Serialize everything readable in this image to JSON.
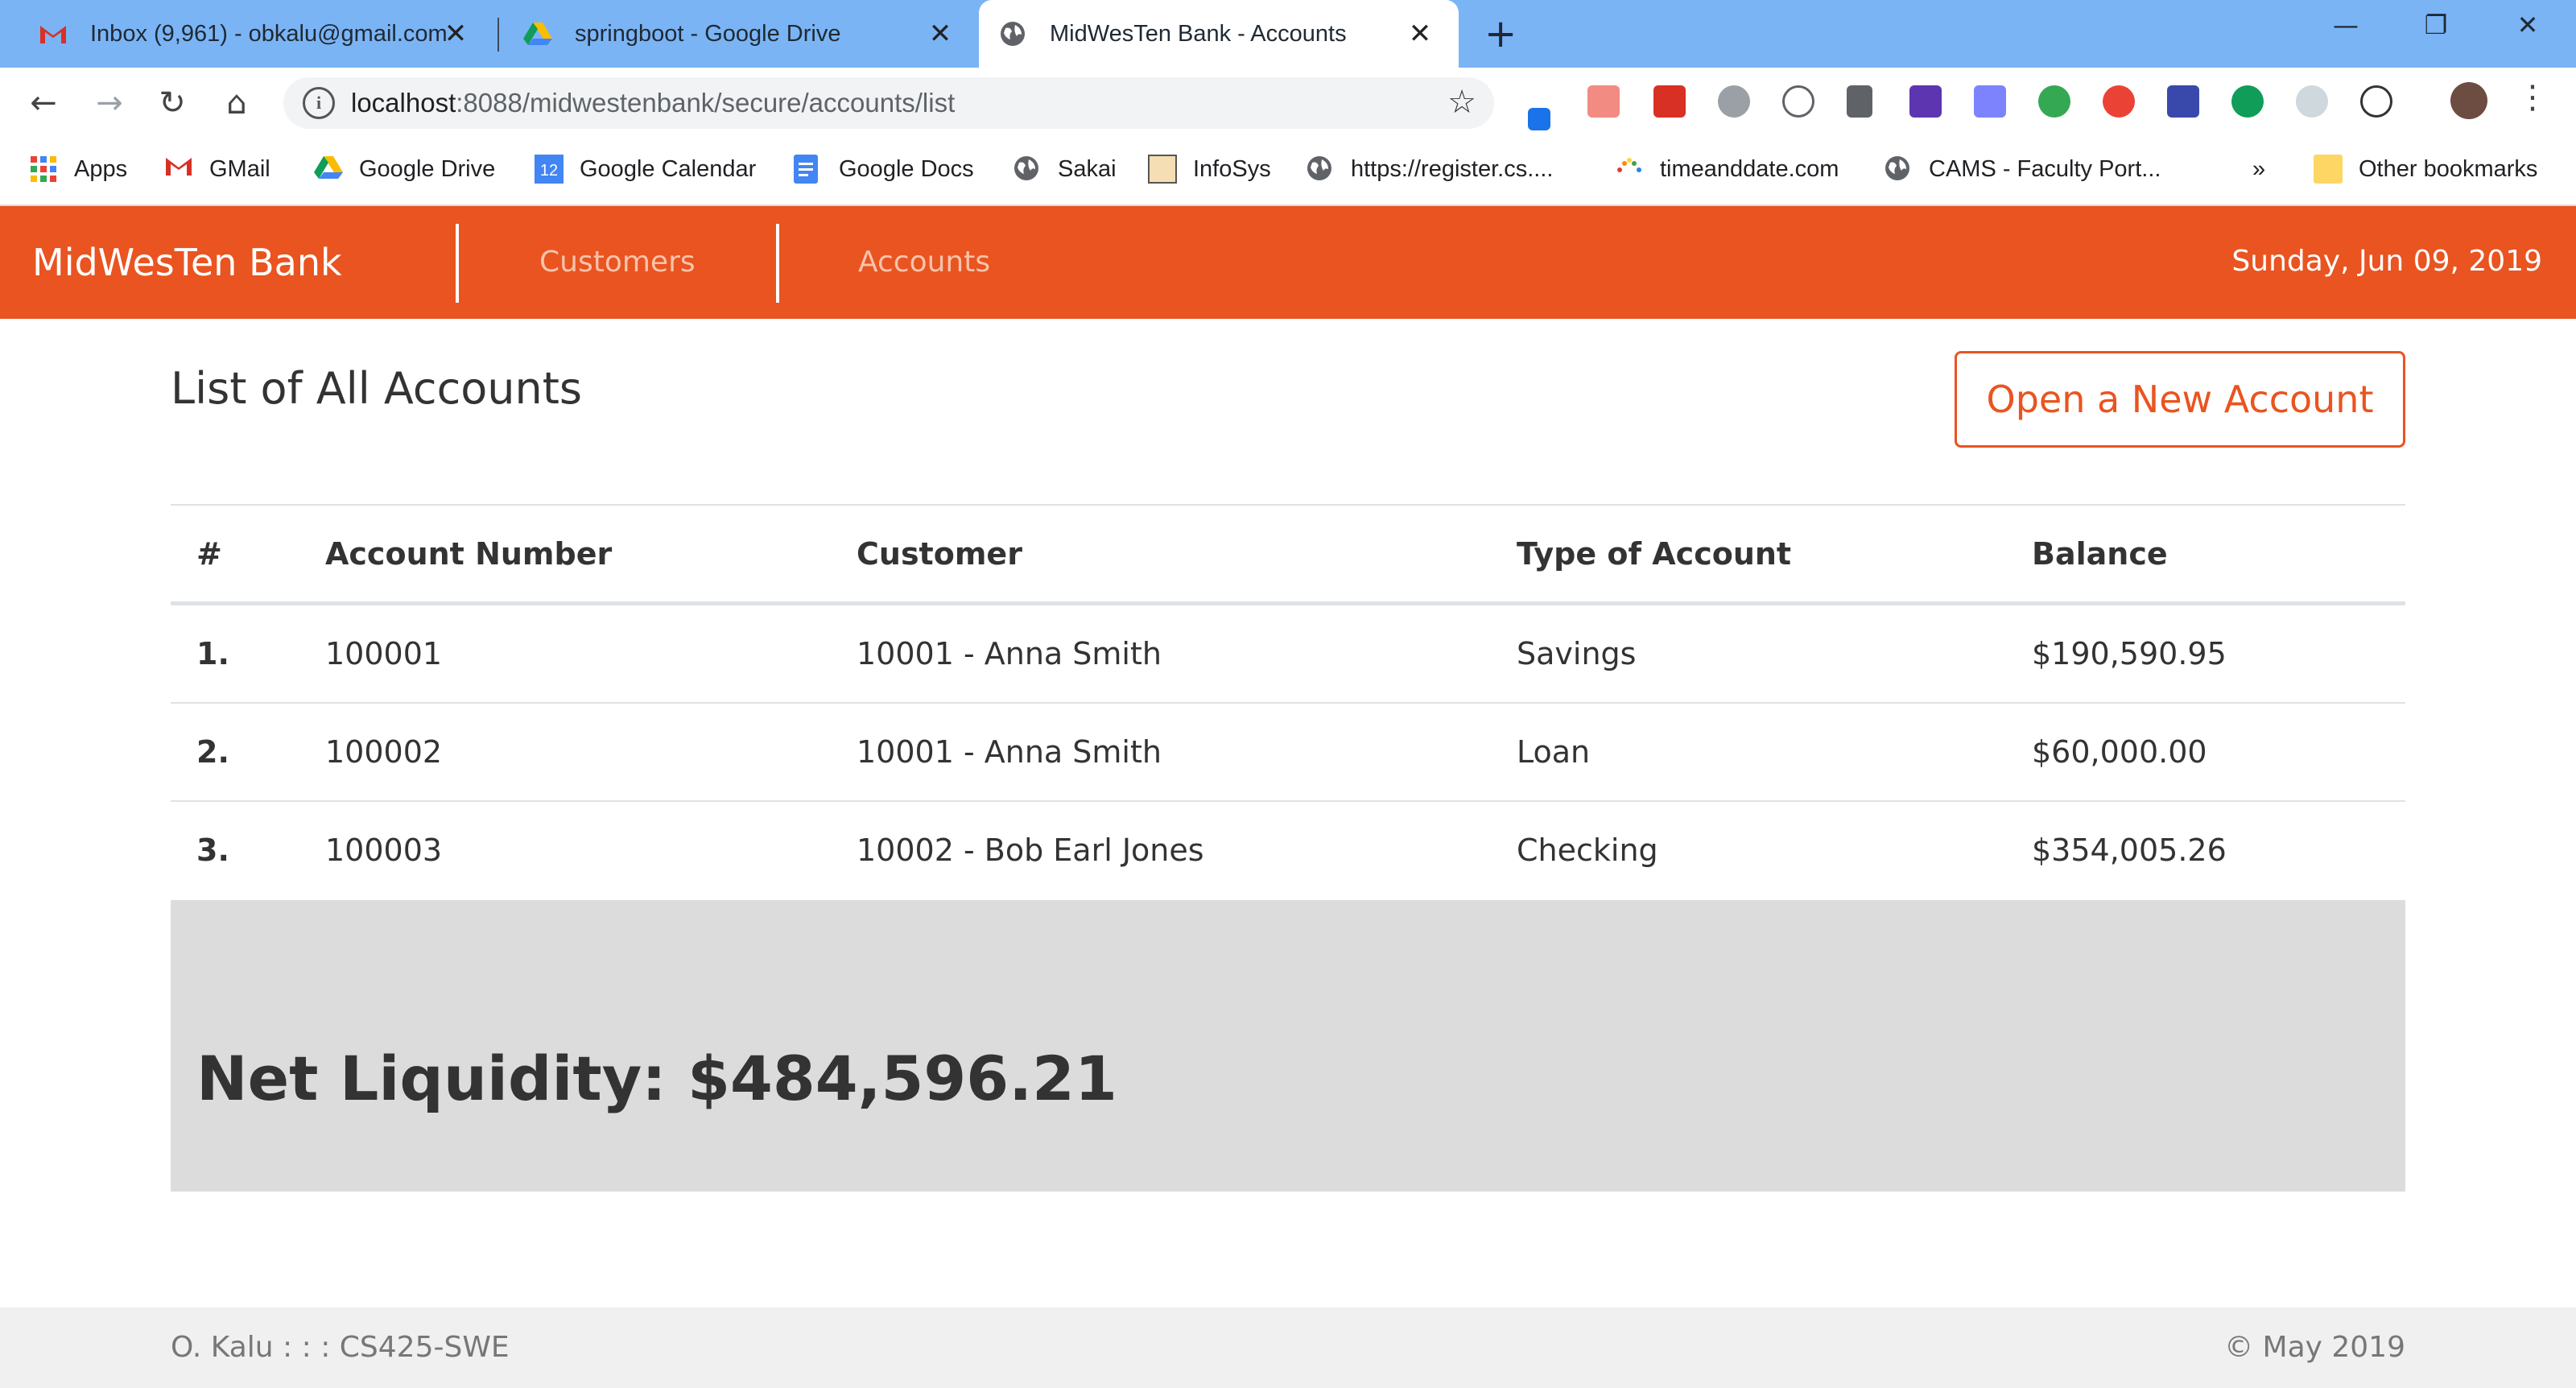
{
  "browser": {
    "tabs": [
      {
        "title": "Inbox (9,961) - obkalu@gmail.com",
        "icon": "gmail-icon"
      },
      {
        "title": "springboot - Google Drive",
        "icon": "google-drive-icon"
      },
      {
        "title": "MidWesTen Bank - Accounts",
        "icon": "globe-icon",
        "active": true
      }
    ],
    "url_host": "localhost",
    "url_path": ":8088/midwestenbank/secure/accounts/list",
    "bookmarks": [
      {
        "label": "Apps",
        "icon": "apps-grid-icon"
      },
      {
        "label": "GMail",
        "icon": "gmail-icon"
      },
      {
        "label": "Google Drive",
        "icon": "google-drive-icon"
      },
      {
        "label": "Google Calendar",
        "icon": "google-calendar-icon"
      },
      {
        "label": "Google Docs",
        "icon": "google-docs-icon"
      },
      {
        "label": "Sakai",
        "icon": "globe-icon"
      },
      {
        "label": "InfoSys",
        "icon": "infosys-icon"
      },
      {
        "label": "https://register.cs....",
        "icon": "globe-icon"
      },
      {
        "label": "timeanddate.com",
        "icon": "timeanddate-icon"
      },
      {
        "label": "CAMS - Faculty Port...",
        "icon": "globe-icon"
      }
    ],
    "overflow_label": "»",
    "other_bookmarks": "Other bookmarks",
    "calendar_day": "12"
  },
  "app": {
    "brand": "MidWesTen Bank",
    "nav": {
      "customers": "Customers",
      "accounts": "Accounts"
    },
    "date": "Sunday, Jun 09, 2019",
    "accent_color": "#e95420"
  },
  "main": {
    "title": "List of All Accounts",
    "open_button": "Open a New Account",
    "table": {
      "columns": [
        "#",
        "Account Number",
        "Customer",
        "Type of Account",
        "Balance"
      ],
      "rows": [
        {
          "index": "1.",
          "account_number": "100001",
          "customer": "10001 - Anna Smith",
          "type": "Savings",
          "balance": "$190,590.95"
        },
        {
          "index": "2.",
          "account_number": "100002",
          "customer": "10001 - Anna Smith",
          "type": "Loan",
          "balance": "$60,000.00"
        },
        {
          "index": "3.",
          "account_number": "100003",
          "customer": "10002 - Bob Earl Jones",
          "type": "Checking",
          "balance": "$354,005.26"
        }
      ]
    },
    "net_liquidity": "Net Liquidity: $484,596.21"
  },
  "footer": {
    "left": "O. Kalu : : : CS425-SWE",
    "right": "© May 2019"
  }
}
